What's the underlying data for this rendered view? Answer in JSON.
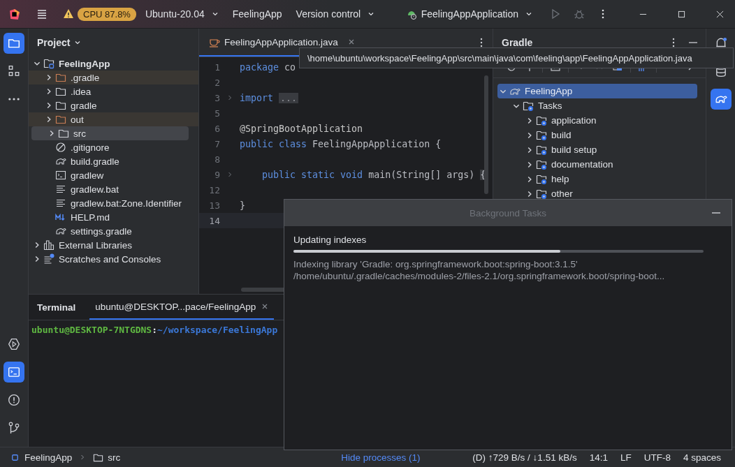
{
  "title_bar": {
    "cpu_badge": "CPU 87.8%",
    "environment": "Ubuntu-20.04",
    "project": "FeelingApp",
    "vcs": "Version control",
    "run_config": "FeelingAppApplication"
  },
  "left_toolbar": {
    "top": [
      {
        "kind": "project",
        "selected": true
      },
      {
        "kind": "structure",
        "selected": false
      },
      {
        "kind": "more",
        "selected": false
      }
    ],
    "bottom": [
      {
        "kind": "services",
        "selected": false
      },
      {
        "kind": "terminal",
        "selected": true
      },
      {
        "kind": "problems",
        "selected": false
      },
      {
        "kind": "git",
        "selected": false
      }
    ]
  },
  "project_panel": {
    "title": "Project",
    "tree": [
      {
        "label": "FeelingApp",
        "kind": "module",
        "expanded": true,
        "selected": false,
        "children": [
          {
            "label": ".gradle",
            "kind": "folder",
            "excluded": true,
            "expanded": false,
            "selected": false
          },
          {
            "label": ".idea",
            "kind": "folder",
            "excluded": false,
            "expanded": false,
            "selected": false
          },
          {
            "label": "gradle",
            "kind": "folder",
            "excluded": false,
            "expanded": false,
            "selected": false
          },
          {
            "label": "out",
            "kind": "folder",
            "excluded": true,
            "expanded": false,
            "selected": false
          },
          {
            "label": "src",
            "kind": "folder",
            "excluded": false,
            "expanded": false,
            "selected": true
          },
          {
            "label": ".gitignore",
            "kind": "ignore",
            "selected": false
          },
          {
            "label": "build.gradle",
            "kind": "gradle",
            "selected": false
          },
          {
            "label": "gradlew",
            "kind": "shell",
            "selected": false
          },
          {
            "label": "gradlew.bat",
            "kind": "text",
            "selected": false
          },
          {
            "label": "gradlew.bat:Zone.Identifier",
            "kind": "text",
            "selected": false
          },
          {
            "label": "HELP.md",
            "kind": "markdown",
            "selected": false
          },
          {
            "label": "settings.gradle",
            "kind": "gradle",
            "selected": false
          }
        ]
      },
      {
        "label": "External Libraries",
        "kind": "library",
        "expanded": false,
        "selected": false
      },
      {
        "label": "Scratches and Consoles",
        "kind": "scratches",
        "expanded": false,
        "selected": false
      }
    ]
  },
  "editor": {
    "tab": {
      "label": "FeelingAppApplication.java",
      "selected": true
    },
    "lines": [
      {
        "number": "1",
        "fold": false,
        "current": false,
        "tokens": [
          {
            "text": "package",
            "kind": "keyword"
          },
          {
            "text": " co",
            "kind": "plain"
          }
        ]
      },
      {
        "number": "2",
        "fold": false,
        "current": false
      },
      {
        "number": "3",
        "fold": true,
        "current": false,
        "tokens": [
          {
            "text": "import",
            "kind": "keyword"
          },
          {
            "text": "...",
            "kind": "folded"
          }
        ]
      },
      {
        "number": "5",
        "fold": false,
        "current": false
      },
      {
        "number": "6",
        "fold": false,
        "current": false,
        "tokens": [
          {
            "text": "@SpringBootApplication",
            "kind": "annotation"
          }
        ]
      },
      {
        "number": "7",
        "fold": false,
        "current": false,
        "tokens": [
          {
            "text": "public class",
            "kind": "keyword"
          },
          {
            "text": " FeelingAppApplication {",
            "kind": "plain"
          }
        ]
      },
      {
        "number": "8",
        "fold": false,
        "current": false
      },
      {
        "number": "9",
        "fold": true,
        "current": false,
        "tokens": [
          {
            "text": "    public static void",
            "kind": "keyword"
          },
          {
            "text": " main(String[] args) ",
            "kind": "plain"
          },
          {
            "text": "{",
            "kind": "brace"
          }
        ]
      },
      {
        "number": "12",
        "fold": false,
        "current": false
      },
      {
        "number": "13",
        "fold": false,
        "current": false,
        "tokens": [
          {
            "text": "}",
            "kind": "plain"
          }
        ]
      },
      {
        "number": "14",
        "fold": false,
        "current": true
      }
    ]
  },
  "tooltip": {
    "text": "\\home\\ubuntu\\workspace\\FeelingApp\\src\\main\\java\\com\\feeling\\app\\FeelingAppApplication.java"
  },
  "gradle_panel": {
    "title": "Gradle",
    "tree": [
      {
        "label": "FeelingApp",
        "kind": "project",
        "expanded": true,
        "selected": true,
        "children": [
          {
            "label": "Tasks",
            "kind": "tasks",
            "expanded": true,
            "selected": false,
            "children": [
              {
                "label": "application",
                "kind": "tasks",
                "expanded": false,
                "selected": false
              },
              {
                "label": "build",
                "kind": "tasks",
                "expanded": false,
                "selected": false
              },
              {
                "label": "build setup",
                "kind": "tasks",
                "expanded": false,
                "selected": false
              },
              {
                "label": "documentation",
                "kind": "tasks",
                "expanded": false,
                "selected": false
              },
              {
                "label": "help",
                "kind": "tasks",
                "expanded": false,
                "selected": false
              },
              {
                "label": "other",
                "kind": "tasks",
                "expanded": false,
                "selected": false
              }
            ]
          }
        ]
      }
    ]
  },
  "right_toolbar": [
    {
      "kind": "notifications",
      "selected": false
    },
    {
      "kind": "database",
      "selected": false
    },
    {
      "kind": "gradle",
      "selected": true
    }
  ],
  "terminal": {
    "title": "Terminal",
    "tabs": [
      {
        "label": "ubuntu@DESKTOP...pace/FeelingApp",
        "selected": true
      }
    ],
    "prompt": {
      "user_host": "ubuntu@DESKTOP-7NTGDNS",
      "separator": ":",
      "path": "~/workspace/FeelingApp"
    }
  },
  "background_tasks": {
    "title": "Background Tasks",
    "task": "Updating indexes",
    "level": 0.65,
    "details": [
      "Indexing library 'Gradle: org.springframework.boot:spring-boot:3.1.5'",
      "/home/ubuntu/.gradle/caches/modules-2/files-2.1/org.springframework.boot/spring-boot..."
    ]
  },
  "status_bar": {
    "breadcrumb": [
      "FeelingApp",
      "src"
    ],
    "link": "Hide processes (1)",
    "items": [
      "(D) ↑729 B/s / ↓1.51 kB/s",
      "14:1",
      "LF",
      "UTF-8",
      "4 spaces"
    ]
  }
}
